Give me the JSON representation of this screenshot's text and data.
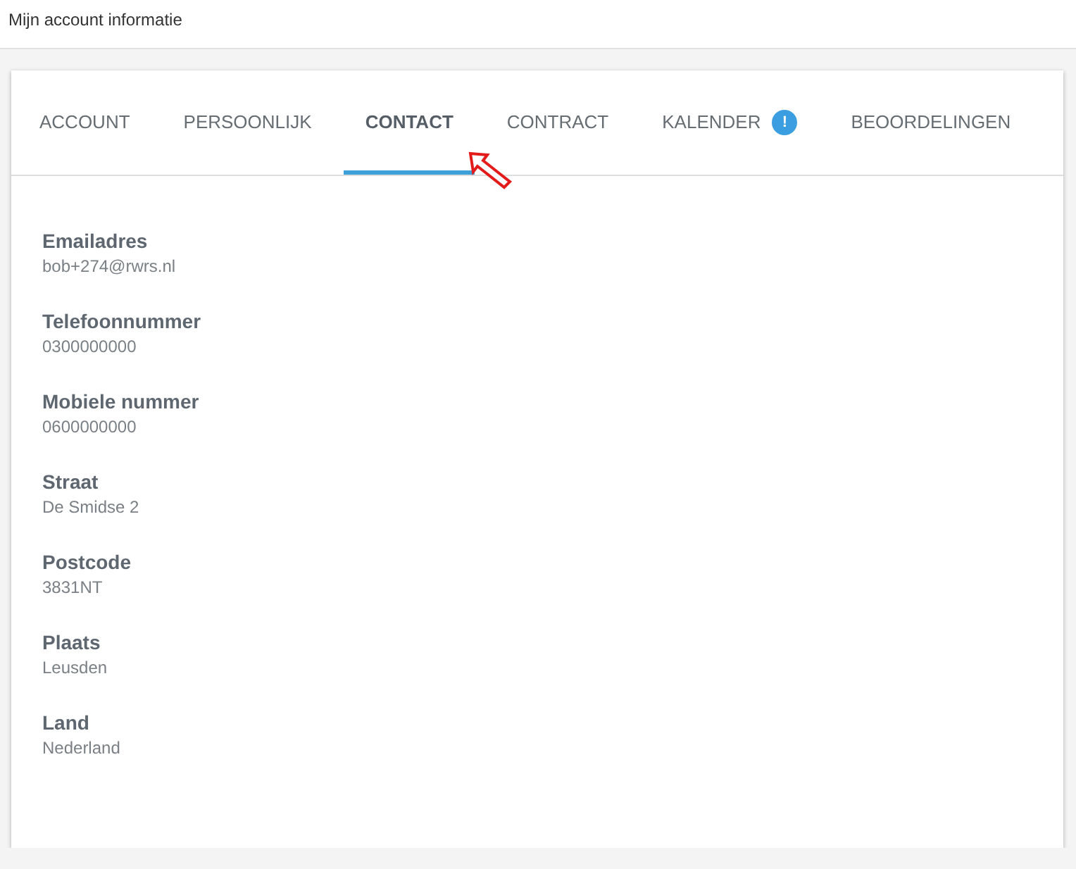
{
  "page_title": "Mijn account informatie",
  "tabs": [
    {
      "label": "ACCOUNT",
      "selected": false
    },
    {
      "label": "PERSOONLIJK",
      "selected": false
    },
    {
      "label": "CONTACT",
      "selected": true
    },
    {
      "label": "CONTRACT",
      "selected": false
    },
    {
      "label": "KALENDER",
      "selected": false,
      "badge": "!"
    },
    {
      "label": "BEOORDELINGEN",
      "selected": false
    }
  ],
  "fields": [
    {
      "label": "Emailadres",
      "value": "bob+274@rwrs.nl"
    },
    {
      "label": "Telefoonnummer",
      "value": "0300000000"
    },
    {
      "label": "Mobiele nummer",
      "value": "0600000000"
    },
    {
      "label": "Straat",
      "value": "De Smidse 2"
    },
    {
      "label": "Postcode",
      "value": "3831NT"
    },
    {
      "label": "Plaats",
      "value": "Leusden"
    },
    {
      "label": "Land",
      "value": "Nederland"
    }
  ]
}
